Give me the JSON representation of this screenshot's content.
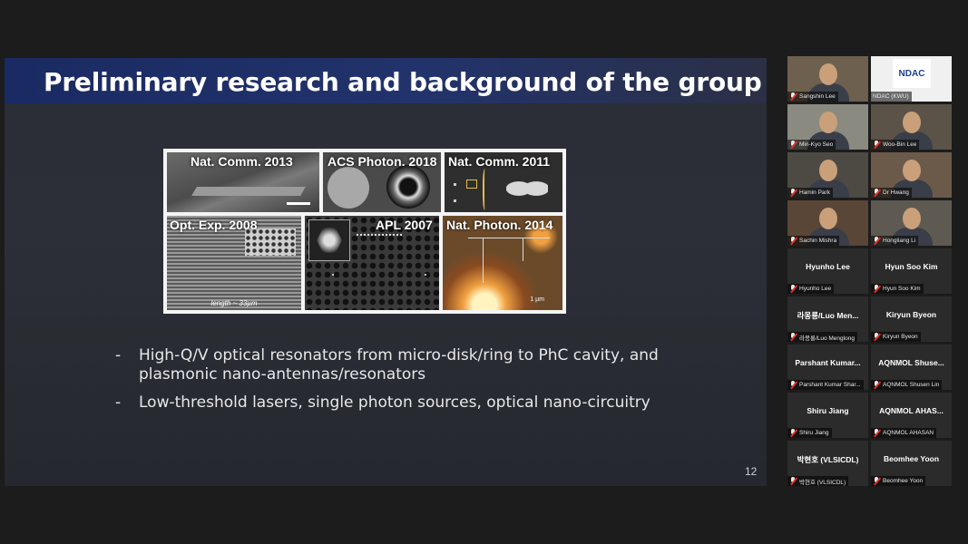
{
  "slide": {
    "title": "Preliminary research and background of the group",
    "figure_labels": {
      "p1": "Nat. Comm. 2013",
      "p2": "ACS Photon. 2018",
      "p3": "Nat. Comm. 2011",
      "p4": "Opt. Exp. 2008",
      "p5": "APL 2007",
      "p6": "Nat. Photon. 2014"
    },
    "p4_length": "length ~ 33µm",
    "p6_scale": "1 µm",
    "bullets": [
      "High-Q/V optical resonators from micro-disk/ring to PhC cavity, and plasmonic nano-antennas/resonators",
      "Low-threshold lasers, single photon sources, optical nano-circuitry"
    ],
    "bullet_marker": "-",
    "page_number": "12"
  },
  "participants": [
    {
      "display": "",
      "label": "Sangshin Lee",
      "video": true,
      "muted": true
    },
    {
      "display": "",
      "label": "NDAC (KWU)",
      "video": true,
      "muted": false,
      "logo_text": "NDAC"
    },
    {
      "display": "",
      "label": "Min-Kyo Seo",
      "video": true,
      "muted": true,
      "active": true
    },
    {
      "display": "",
      "label": "Woo-Bin Lee",
      "video": true,
      "muted": true
    },
    {
      "display": "",
      "label": "Hamin Park",
      "video": true,
      "muted": true
    },
    {
      "display": "",
      "label": "Dr Hwang",
      "video": true,
      "muted": true
    },
    {
      "display": "",
      "label": "Sachin Mishra",
      "video": true,
      "muted": true
    },
    {
      "display": "",
      "label": "Hongliang Li",
      "video": true,
      "muted": true
    },
    {
      "display": "Hyunho Lee",
      "label": "Hyunho Lee",
      "video": false,
      "muted": true
    },
    {
      "display": "Hyun Soo Kim",
      "label": "Hyun Soo Kim",
      "video": false,
      "muted": true
    },
    {
      "display": "라몽룡/Luo Men...",
      "label": "라몽룡/Luo Menglong",
      "video": false,
      "muted": true
    },
    {
      "display": "Kiryun Byeon",
      "label": "Kiryun Byeon",
      "video": false,
      "muted": true
    },
    {
      "display": "Parshant Kumar...",
      "label": "Parshant Kumar Shar...",
      "video": false,
      "muted": true
    },
    {
      "display": "AQNMOL Shuse...",
      "label": "AQNMOL Shusen Lin",
      "video": false,
      "muted": true
    },
    {
      "display": "Shiru Jiang",
      "label": "Shiru Jiang",
      "video": false,
      "muted": true
    },
    {
      "display": "AQNMOL AHAS...",
      "label": "AQNMOL AHASAN",
      "video": false,
      "muted": true
    },
    {
      "display": "박현호 (VLSICDL)",
      "label": "박현호 (VLSICDL)",
      "video": false,
      "muted": true
    },
    {
      "display": "Beomhee Yoon",
      "label": "Beomhee Yoon",
      "video": false,
      "muted": true
    }
  ],
  "colors": {
    "background": "#1c1c1c",
    "title_band": "#1a2a62",
    "active_speaker": "#a6d36a",
    "muted_mic": "#e0302a"
  }
}
